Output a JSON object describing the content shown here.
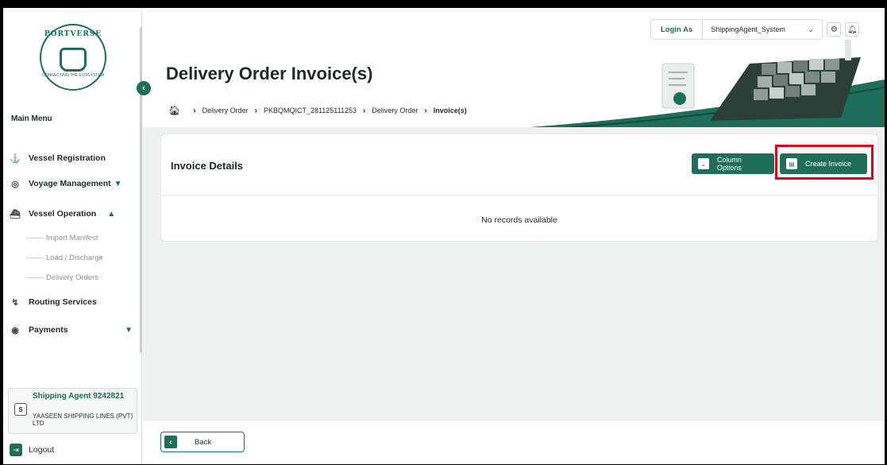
{
  "colors": {
    "brand": "#1e6e5a",
    "highlight": "#e0001b",
    "background": "#eef1f0"
  },
  "logo": {
    "top_text": "PORTVERSE",
    "bottom_text": "CONNECTING THE ECOSYSTEM"
  },
  "sidebar": {
    "main_menu_label": "Main Menu",
    "items": [
      {
        "label": "Vessel Registration",
        "icon": "ship-icon"
      },
      {
        "label": "Voyage Management",
        "icon": "compass-icon",
        "chevron": "down"
      },
      {
        "label": "Vessel Operation",
        "icon": "cargo-ship-icon",
        "chevron": "up",
        "sub_items": [
          "Import Manifest",
          "Load / Discharge",
          "Delivery Orders"
        ]
      },
      {
        "label": "Routing Services",
        "icon": "route-icon"
      },
      {
        "label": "Payments",
        "icon": "coin-icon",
        "chevron": "down"
      }
    ],
    "user": {
      "avatar": "S",
      "name": "Shipping Agent 9242821",
      "company": "YAASEEN SHIPPING LINES (PVT) LTD"
    },
    "logout_label": "Logout"
  },
  "topbar": {
    "login_as_label": "Login As",
    "login_as_value": "ShippingAgent_System",
    "icons": [
      "settings-icon",
      "notification-bell-icon"
    ]
  },
  "header": {
    "title": "Delivery Order Invoice(s)",
    "breadcrumb": [
      "Delivery Order",
      "PKBQMQICT_281125111253",
      "Delivery Order",
      "Invoice(s)"
    ]
  },
  "card": {
    "title": "Invoice Details",
    "column_options_label": "Column Options",
    "create_invoice_label": "Create Invoice",
    "empty_message": "No records available"
  },
  "footer": {
    "back_label": "Back"
  }
}
